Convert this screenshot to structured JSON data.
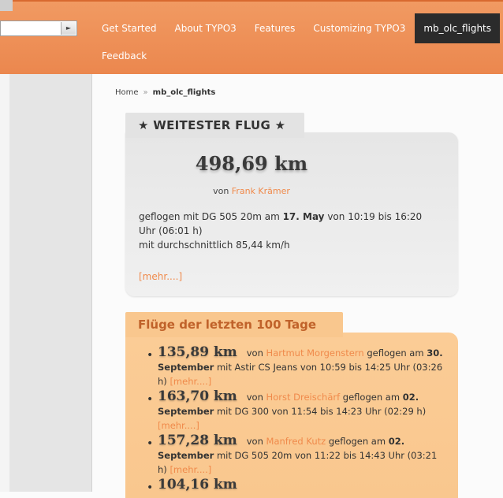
{
  "nav": {
    "select_value": "",
    "items": [
      "Get Started",
      "About TYPO3",
      "Features",
      "Customizing TYPO3",
      "mb_olc_flights"
    ],
    "row2": [
      "Feedback"
    ]
  },
  "breadcrumb": {
    "home": "Home",
    "separator": "»",
    "current": "mb_olc_flights"
  },
  "top_flight": {
    "title": "★ WEITESTER FLUG ★",
    "distance": "498,69 km",
    "von_label": "von",
    "pilot": "Frank Krämer",
    "line1_a": "geflogen mit DG 505 20m am ",
    "line1_date": "17. May",
    "line1_b": " von 10:19 bis 16:20 Uhr (06:01 h)",
    "line2": "mit durchschnittlich 85,44 km/h",
    "more": "[mehr....]"
  },
  "recent": {
    "title": "Flüge der letzten 100 Tage",
    "flights": [
      {
        "km": "135,89 km",
        "von": "von",
        "pilot": "Hartmut Morgenstern",
        "a": " geflogen am ",
        "date": "30. September",
        "b": " mit Astir CS Jeans von 10:59 bis 14:25 Uhr (03:26 h) ",
        "more": "[mehr....]"
      },
      {
        "km": "163,70 km",
        "von": "von",
        "pilot": "Horst Dreischärf",
        "a": " geflogen am ",
        "date": "02. September",
        "b": " mit DG 300 von 11:54 bis 14:23 Uhr (02:29 h) ",
        "more": "[mehr....]"
      },
      {
        "km": "157,28 km",
        "von": "von",
        "pilot": "Manfred Kutz",
        "a": " geflogen am ",
        "date": "02. September",
        "b": " mit DG 505 20m von 11:22 bis 14:43 Uhr (03:21 h) ",
        "more": "[mehr....]"
      },
      {
        "km": "104,16 km",
        "von": "",
        "pilot": "",
        "a": "",
        "date": "",
        "b": "",
        "more": ""
      }
    ]
  },
  "colors": {
    "accent": "#eb874e",
    "link": "#f08a4b",
    "active_tab": "#2b2b2b",
    "recent_bg": "#f9c78e"
  }
}
